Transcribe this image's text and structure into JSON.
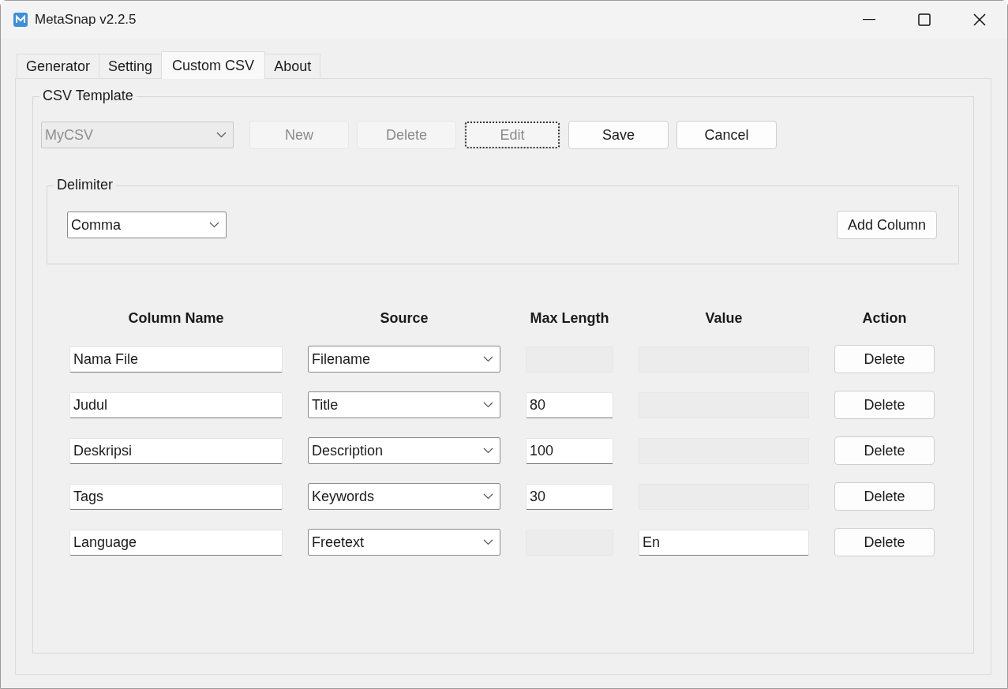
{
  "window": {
    "title": "MetaSnap v2.2.5"
  },
  "tabs": [
    {
      "label": "Generator",
      "selected": false
    },
    {
      "label": "Setting",
      "selected": false
    },
    {
      "label": "Custom CSV",
      "selected": true
    },
    {
      "label": "About",
      "selected": false
    }
  ],
  "csv_template": {
    "label": "CSV Template",
    "template": {
      "value": "MyCSV",
      "disabled": true
    },
    "buttons": [
      {
        "label": "New",
        "disabled": true,
        "focused": false
      },
      {
        "label": "Delete",
        "disabled": true,
        "focused": false
      },
      {
        "label": "Edit",
        "disabled": true,
        "focused": true
      },
      {
        "label": "Save",
        "disabled": false,
        "focused": false
      },
      {
        "label": "Cancel",
        "disabled": false,
        "focused": false
      }
    ]
  },
  "delimiter": {
    "label": "Delimiter",
    "value": "Comma"
  },
  "add_column_button": "Add Column",
  "table": {
    "columns": [
      "Column Name",
      "Source",
      "Max Length",
      "Value",
      "Action"
    ],
    "rows": [
      {
        "column_name": "Nama File",
        "source": "Filename",
        "max_length_disabled": true,
        "value_disabled": true,
        "action": "Delete"
      },
      {
        "column_name": "Judul",
        "source": "Title",
        "max_length": "80",
        "max_length_disabled": false,
        "value_disabled": true,
        "action": "Delete"
      },
      {
        "column_name": "Deskripsi",
        "source": "Description",
        "max_length": "100",
        "max_length_disabled": false,
        "value_disabled": true,
        "action": "Delete"
      },
      {
        "column_name": "Tags",
        "source": "Keywords",
        "max_length": "30",
        "max_length_disabled": false,
        "value_disabled": true,
        "action": "Delete"
      },
      {
        "column_name": "Language",
        "source": "Freetext",
        "max_length_disabled": true,
        "value": "En",
        "value_disabled": false,
        "action": "Delete"
      }
    ]
  }
}
